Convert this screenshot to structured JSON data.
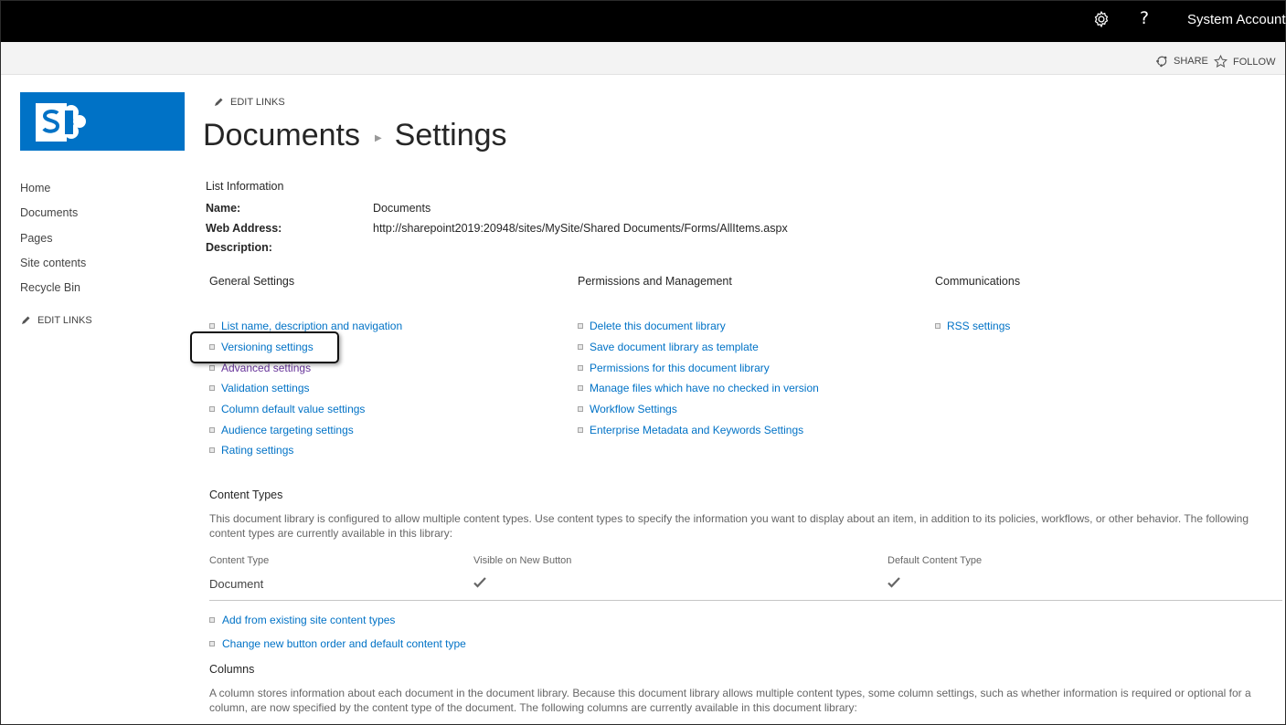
{
  "suitebar": {
    "gear_icon": "gear-icon",
    "help_label": "?",
    "account_name": "System Account"
  },
  "ribbon": {
    "share_label": "SHARE",
    "follow_label": "FOLLOW"
  },
  "logo": {
    "icon": "sharepoint-logo",
    "color": "#0072c6"
  },
  "leftnav": {
    "items": [
      {
        "label": "Home"
      },
      {
        "label": "Documents"
      },
      {
        "label": "Pages"
      },
      {
        "label": "Site contents"
      },
      {
        "label": "Recycle Bin"
      }
    ],
    "edit_links_label": "EDIT LINKS"
  },
  "header": {
    "edit_links_label": "EDIT LINKS",
    "breadcrumb_parent": "Documents",
    "breadcrumb_current": "Settings"
  },
  "list_info": {
    "heading": "List Information",
    "name_label": "Name:",
    "name_value": "Documents",
    "web_address_label": "Web Address:",
    "web_address_value": "http://sharepoint2019:20948/sites/MySite/Shared Documents/Forms/AllItems.aspx",
    "description_label": "Description:"
  },
  "general_settings": {
    "heading": "General Settings",
    "links": [
      {
        "label": "List name, description and navigation"
      },
      {
        "label": "Versioning settings"
      },
      {
        "label": "Advanced settings"
      },
      {
        "label": "Validation settings"
      },
      {
        "label": "Column default value settings"
      },
      {
        "label": "Audience targeting settings"
      },
      {
        "label": "Rating settings"
      }
    ]
  },
  "permissions": {
    "heading": "Permissions and Management",
    "links": [
      {
        "label": "Delete this document library"
      },
      {
        "label": "Save document library as template"
      },
      {
        "label": "Permissions for this document library"
      },
      {
        "label": "Manage files which have no checked in version"
      },
      {
        "label": "Workflow Settings"
      },
      {
        "label": "Enterprise Metadata and Keywords Settings"
      }
    ]
  },
  "communications": {
    "heading": "Communications",
    "links": [
      {
        "label": "RSS settings"
      }
    ]
  },
  "content_types": {
    "heading": "Content Types",
    "description": "This document library is configured to allow multiple content types. Use content types to specify the information you want to display about an item, in addition to its policies, workflows, or other behavior. The following content types are currently available in this library:",
    "columns": [
      "Content Type",
      "Visible on New Button",
      "Default Content Type"
    ],
    "rows": [
      {
        "name": "Document",
        "visible": true,
        "default": true
      }
    ],
    "links": [
      {
        "label": "Add from existing site content types"
      },
      {
        "label": "Change new button order and default content type"
      }
    ]
  },
  "columns_section": {
    "heading": "Columns",
    "description": "A column stores information about each document in the document library. Because this document library allows multiple content types, some column settings, such as whether information is required or optional for a column, are now specified by the content type of the document. The following columns are currently available in this document library:"
  },
  "colors": {
    "link": "#0072c6",
    "visited_link": "#663399",
    "suitebar": "#000000",
    "accent": "#0072c6"
  }
}
